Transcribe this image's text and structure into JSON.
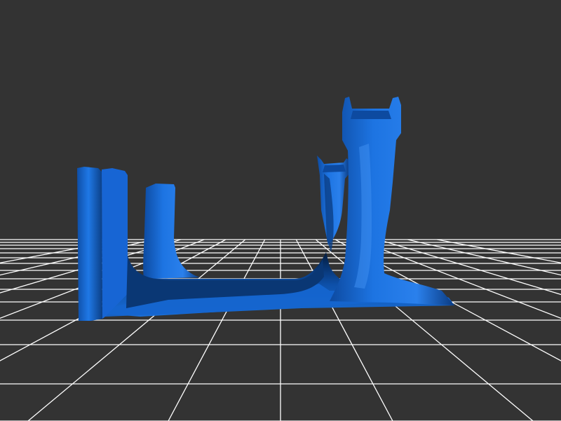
{
  "viewer": {
    "background_color": "#333333",
    "grid_color": "#ffffff",
    "model_color": "#1a6fd8",
    "model_shade_color": "#0b3f86",
    "model_highlight_color": "#3e8ef0",
    "model_dark_color": "#06264f",
    "camera_controls": "orbit"
  }
}
